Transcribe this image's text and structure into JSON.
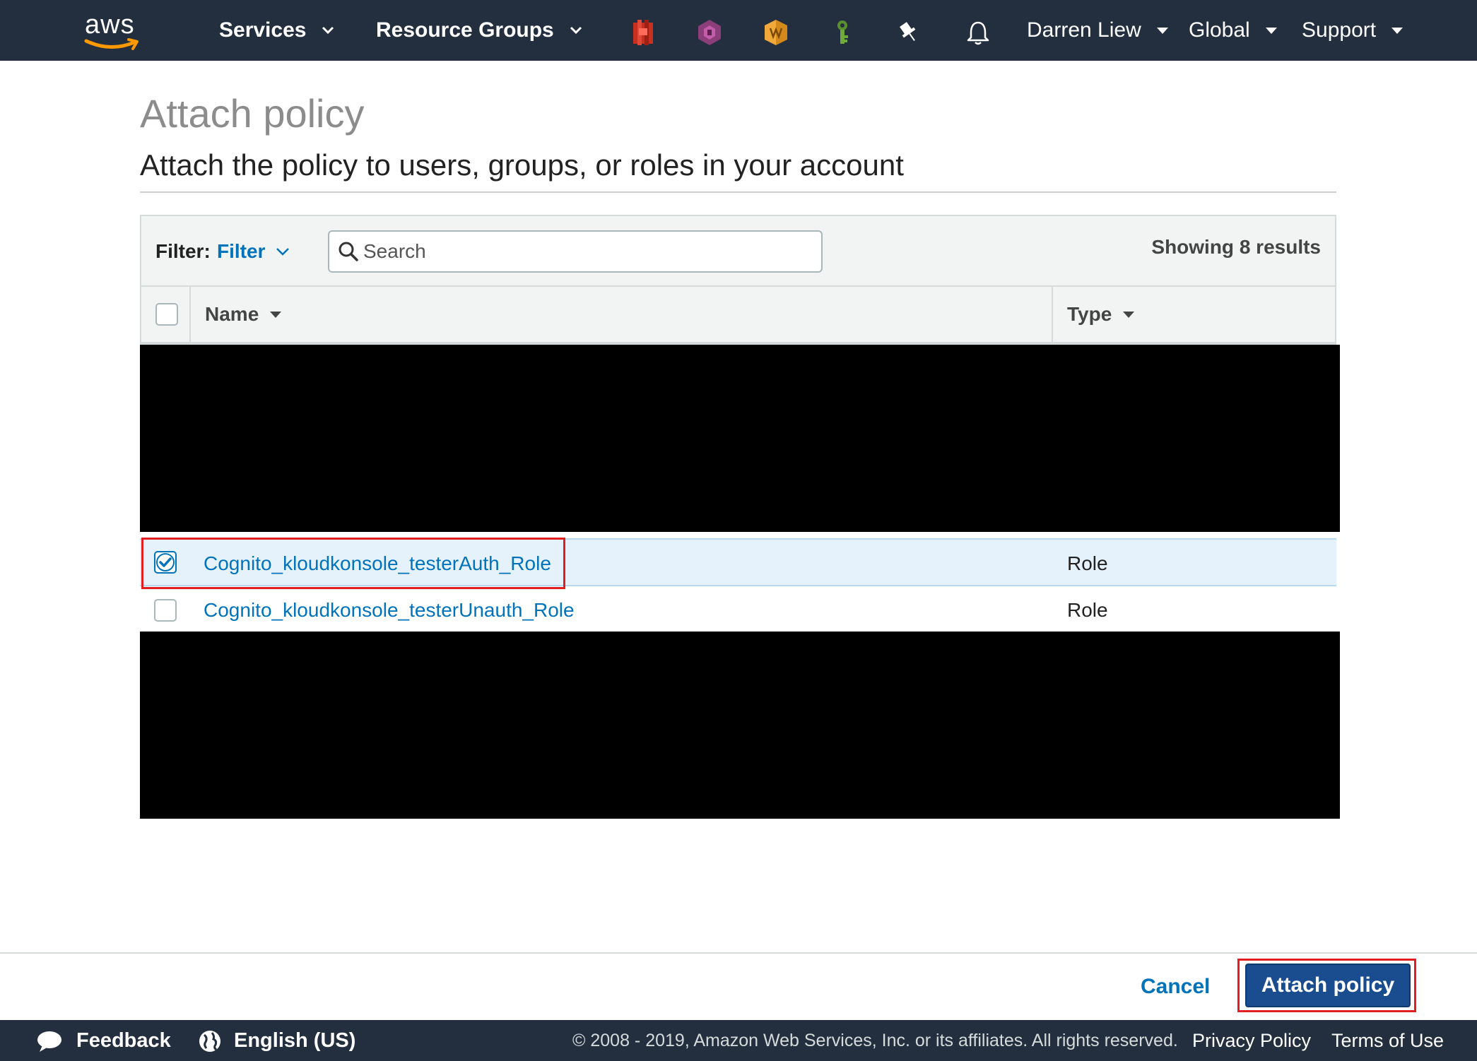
{
  "topnav": {
    "logo_text": "aws",
    "services_label": "Services",
    "resource_groups_label": "Resource Groups",
    "pinned_icons": [
      "red-service-icon",
      "purple-service-icon",
      "orange-service-icon",
      "green-key-icon"
    ],
    "pin_icon": "pin-icon",
    "bell_icon": "bell-icon",
    "user_label": "Darren Liew",
    "region_label": "Global",
    "support_label": "Support"
  },
  "page": {
    "title": "Attach policy",
    "subtitle": "Attach the policy to users, groups, or roles in your account"
  },
  "filter_bar": {
    "filter_label": "Filter:",
    "filter_value": "Filter",
    "search_placeholder": "Search",
    "results_text": "Showing 8 results"
  },
  "table": {
    "columns": [
      "Name",
      "Type"
    ],
    "rows": [
      {
        "name": "Cognito_kloudkonsole_testerAuth_Role",
        "type": "Role",
        "checked": true
      },
      {
        "name": "Cognito_kloudkonsole_testerUnauth_Role",
        "type": "Role",
        "checked": false
      }
    ]
  },
  "actions": {
    "cancel_label": "Cancel",
    "attach_label": "Attach policy"
  },
  "footer": {
    "feedback_label": "Feedback",
    "language_label": "English (US)",
    "copyright": "© 2008 - 2019, Amazon Web Services, Inc. or its affiliates. All rights reserved.",
    "privacy_label": "Privacy Policy",
    "terms_label": "Terms of Use"
  },
  "colors": {
    "nav_bg": "#232f3e",
    "link_blue": "#0073bb",
    "primary_button": "#1a4d8f",
    "highlight_red": "#e02020",
    "selected_row_bg": "#e6f2fb"
  }
}
